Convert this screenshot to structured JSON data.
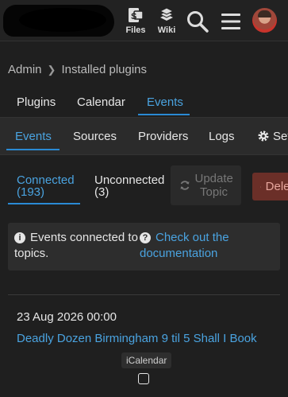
{
  "header": {
    "files_label": "Files",
    "wiki_label": "Wiki"
  },
  "breadcrumb": {
    "root": "Admin",
    "current": "Installed plugins"
  },
  "plugin_nav": {
    "items": [
      "Plugins",
      "Calendar",
      "Events"
    ],
    "active": "Events"
  },
  "events_nav": {
    "items": [
      "Events",
      "Sources",
      "Providers",
      "Logs",
      "Settings"
    ],
    "active": "Events"
  },
  "filters": {
    "connected_label": "Connected",
    "connected_count": "(193)",
    "unconnected_label": "Unconnected",
    "unconnected_count": "(3)",
    "update_topic_label": "Update Topic",
    "delete_label": "Delete"
  },
  "info": {
    "message": "Events connected to topics.",
    "link_text": "Check out the documentation"
  },
  "event": {
    "date": "23 Aug 2026 00:00",
    "title": "Deadly Dozen Birmingham 9 til 5 Shall I Book",
    "source": "iCalendar"
  },
  "colors": {
    "accent": "#4aa3e0",
    "danger": "#6b2f28",
    "background": "#1f1f1f"
  }
}
